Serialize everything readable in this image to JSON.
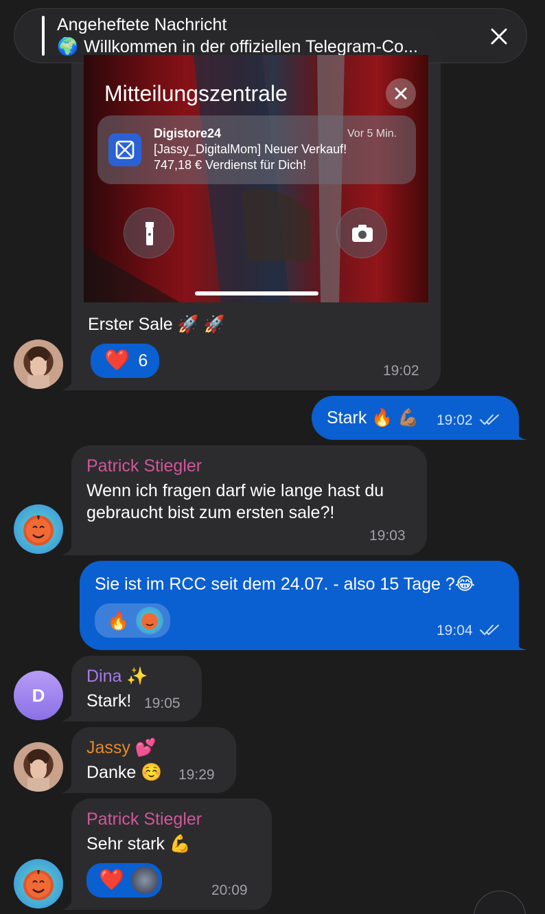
{
  "pinned": {
    "title": "Angeheftete Nachricht",
    "globe": "🌍",
    "text": "Willkommen in der offiziellen Telegram-Co..."
  },
  "image_msg": {
    "screen_title": "Mitteilungszentrale",
    "notif_app": "Digistore24",
    "notif_ago": "Vor 5 Min.",
    "notif_line1": "[Jassy_DigitalMom] Neuer Verkauf!",
    "notif_line2": "747,18 € Verdienst für Dich!",
    "caption": "Erster Sale 🚀 🚀",
    "reaction_emoji": "❤️",
    "reaction_count": "6",
    "time": "19:02"
  },
  "msg_stark_out": {
    "text": "Stark 🔥 💪🏽",
    "time": "19:02"
  },
  "msg_patrick1": {
    "name": "Patrick Stiegler",
    "line1": "Wenn ich fragen darf wie lange hast du",
    "line2": "gebraucht bist zum ersten sale?!",
    "time": "19:03"
  },
  "msg_out2": {
    "text": "Sie ist im RCC seit dem 24.07. - also 15 Tage ?😂",
    "reaction_emoji": "🔥",
    "time": "19:04"
  },
  "msg_dina": {
    "name": "Dina ✨",
    "text": "Stark!",
    "time": "19:05",
    "avatar_letter": "D"
  },
  "msg_jassy": {
    "name": "Jassy 💕",
    "text": "Danke ☺️",
    "time": "19:29"
  },
  "msg_patrick2": {
    "name": "Patrick Stiegler",
    "text": "Sehr stark 💪",
    "reaction_emoji": "❤️",
    "time": "20:09"
  },
  "colors": {
    "background": "#1c1c1d",
    "incoming_bubble": "#2c2c2e",
    "outgoing_bubble": "#0a5fd1",
    "name_patrick": "#d0569a",
    "name_dina": "#a77be8",
    "name_jassy": "#e3892e"
  }
}
